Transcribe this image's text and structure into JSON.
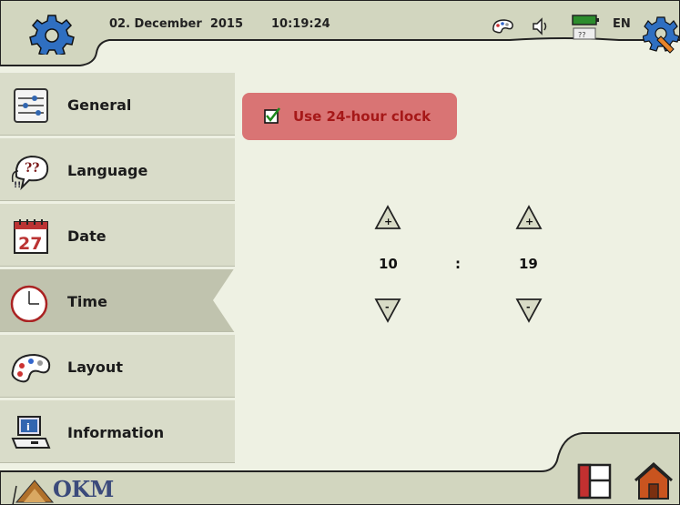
{
  "header": {
    "date": "02. December  2015",
    "time": "10:19:24",
    "language": "EN",
    "icons": [
      "settings-gear-icon",
      "palette-icon",
      "speaker-icon",
      "battery-icon",
      "keyboard-icon",
      "tools-icon"
    ],
    "battery_code": "??"
  },
  "sidebar": {
    "items": [
      {
        "label": "General",
        "icon": "sliders-icon"
      },
      {
        "label": "Language",
        "icon": "speech-bubble-icon"
      },
      {
        "label": "Date",
        "icon": "calendar-icon",
        "day": "27"
      },
      {
        "label": "Time",
        "icon": "clock-icon",
        "active": true
      },
      {
        "label": "Layout",
        "icon": "palette-icon"
      },
      {
        "label": "Information",
        "icon": "computer-info-icon"
      }
    ]
  },
  "main": {
    "clock_toggle": {
      "label": "Use 24-hour clock",
      "checked": true
    },
    "hours": "10",
    "separator": ":",
    "minutes": "19"
  },
  "footer": {
    "logo_text": "OKM",
    "icons": [
      "window-layout-icon",
      "home-icon"
    ]
  },
  "colors": {
    "background": "#eef1e3",
    "sidebar": "#d9dcc9",
    "active": "#c0c3ae",
    "toggle_bg": "#d97474",
    "toggle_text": "#a61818"
  }
}
